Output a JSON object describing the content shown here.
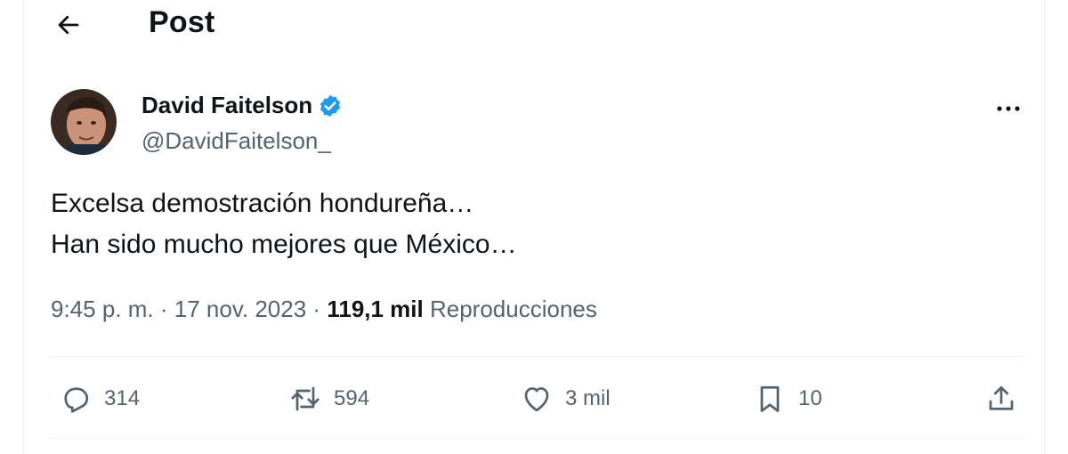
{
  "header": {
    "title": "Post",
    "back_icon": "arrow-left-icon"
  },
  "author": {
    "display_name": "David Faitelson",
    "handle": "@DavidFaitelson_",
    "verified": true,
    "verified_color": "#1d9bf0"
  },
  "tweet": {
    "lines": [
      "Excelsa demostración hondureña…",
      "Han sido mucho mejores que México…"
    ]
  },
  "meta": {
    "time": "9:45 p. m.",
    "separator": "·",
    "date": "17 nov. 2023",
    "views_count": "119,1 mil",
    "views_label": "Reproducciones"
  },
  "actions": {
    "replies": "314",
    "reposts": "594",
    "likes": "3 mil",
    "bookmarks": "10"
  },
  "colors": {
    "text_primary": "#0f1419",
    "text_secondary": "#536471",
    "divider": "#eff3f4",
    "accent": "#1d9bf0"
  }
}
